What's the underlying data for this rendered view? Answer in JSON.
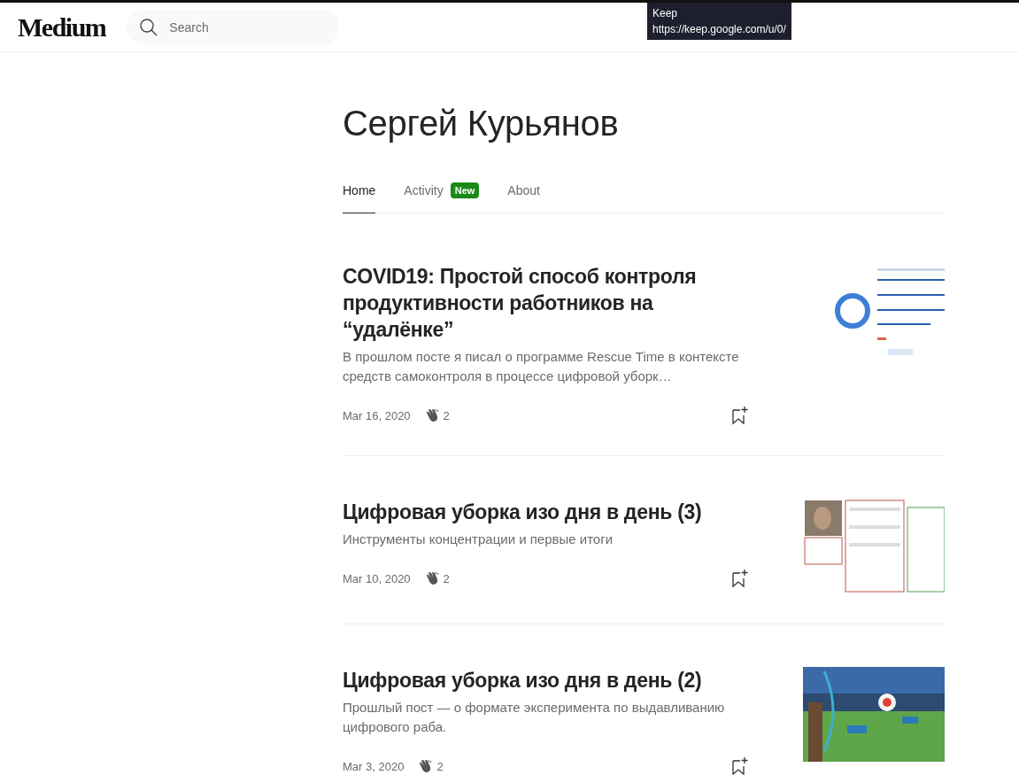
{
  "header": {
    "logo": "Medium",
    "search": {
      "placeholder": "Search"
    }
  },
  "tooltip": {
    "title": "Keep",
    "url": "https://keep.google.com/u/0/"
  },
  "profile": {
    "name": "Сергей Курьянов"
  },
  "tabs": [
    {
      "label": "Home",
      "selected": true
    },
    {
      "label": "Activity",
      "selected": false,
      "badge": "New"
    },
    {
      "label": "About",
      "selected": false
    }
  ],
  "articles": [
    {
      "title": "COVID19: Простой способ контроля продуктивности работников на “удалёнке”",
      "subtitle": "В прошлом посте я писал о программе Rescue Time в контексте средств самоконтроля в процессе цифровой уборк…",
      "date": "Mar 16, 2020",
      "claps": "2"
    },
    {
      "title": "Цифровая уборка изо дня в день (3)",
      "subtitle": "Инструменты концентрации и первые итоги",
      "date": "Mar 10, 2020",
      "claps": "2"
    },
    {
      "title": "Цифровая уборка изо дня в день (2)",
      "subtitle": "Прошлый пост — о формате эксперимента по выдавливанию цифрового раба.",
      "date": "Mar 3, 2020",
      "claps": "2"
    }
  ]
}
